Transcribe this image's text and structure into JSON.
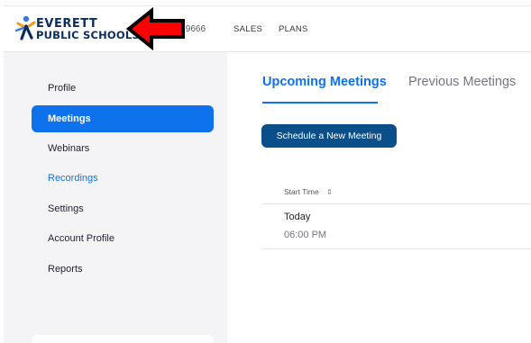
{
  "header": {
    "logo": {
      "line1": "EVERETT",
      "line2": "PUBLIC SCHOOLS"
    },
    "phone_fragment": ".9666",
    "nav": [
      {
        "label": "SALES"
      },
      {
        "label": "PLANS"
      }
    ]
  },
  "sidebar": {
    "items": [
      {
        "label": "Profile",
        "state": "normal"
      },
      {
        "label": "Meetings",
        "state": "active"
      },
      {
        "label": "Webinars",
        "state": "normal"
      },
      {
        "label": "Recordings",
        "state": "link"
      },
      {
        "label": "Settings",
        "state": "normal"
      },
      {
        "label": "Account Profile",
        "state": "normal"
      },
      {
        "label": "Reports",
        "state": "normal"
      }
    ]
  },
  "main": {
    "tabs": [
      {
        "label": "Upcoming Meetings",
        "selected": true
      },
      {
        "label": "Previous Meetings",
        "selected": false
      }
    ],
    "schedule_button": "Schedule a New Meeting",
    "table": {
      "columns": [
        {
          "label": "Start Time",
          "sort_icon": "sort-icon"
        }
      ],
      "rows": [
        {
          "date": "Today",
          "time": "06:00 PM"
        }
      ]
    }
  },
  "annotation": {
    "icon": "red-arrow-left-icon",
    "fill": "#ff0000",
    "stroke": "#000000"
  },
  "colors": {
    "accent": "#0e72ed",
    "button": "#0b4f8a",
    "sidebar_bg": "#f4f4f6"
  }
}
